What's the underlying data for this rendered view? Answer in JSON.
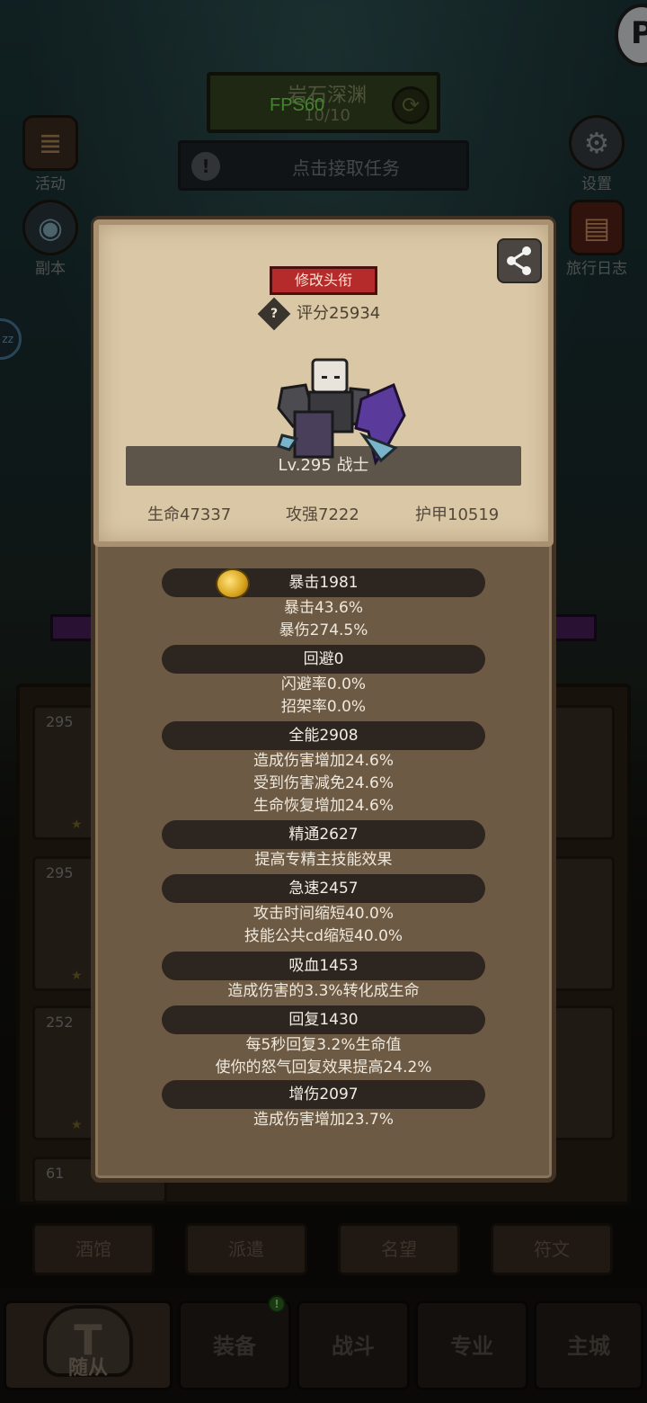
{
  "hud": {
    "zone_name": "岩石深渊",
    "zone_progress": "10/10",
    "fps": "FPS60",
    "quest_text": "点击接取任务",
    "left_buttons": [
      "活动",
      "副本"
    ],
    "right_buttons": [
      "设置",
      "旅行日志"
    ],
    "profile_badge": "P",
    "sleep_badge": "zz"
  },
  "background": {
    "card_levels": [
      "295",
      "295",
      "252",
      "61"
    ],
    "sub_buttons": [
      "酒馆",
      "派遣",
      "名望",
      "符文"
    ]
  },
  "nav": {
    "tabs": [
      "随从",
      "装备",
      "战斗",
      "专业",
      "主城"
    ],
    "badge": "!"
  },
  "panel": {
    "edit_title_label": "修改头衔",
    "score": "评分25934",
    "score_help": "?",
    "level_class": "Lv.295 战士",
    "base_stats": {
      "hp": "生命47337",
      "attack": "攻强7222",
      "armor": "护甲10519"
    },
    "attributes": [
      {
        "name": "暴击1981",
        "lines": [
          "暴击43.6%",
          "暴伤274.5%"
        ]
      },
      {
        "name": "回避0",
        "lines": [
          "闪避率0.0%",
          "招架率0.0%"
        ]
      },
      {
        "name": "全能2908",
        "lines": [
          "造成伤害增加24.6%",
          "受到伤害减免24.6%",
          "生命恢复增加24.6%"
        ]
      },
      {
        "name": "精通2627",
        "lines": [
          "提高专精主技能效果"
        ]
      },
      {
        "name": "急速2457",
        "lines": [
          "攻击时间缩短40.0%",
          "技能公共cd缩短40.0%"
        ]
      },
      {
        "name": "吸血1453",
        "lines": [
          "造成伤害的3.3%转化成生命"
        ]
      },
      {
        "name": "回复1430",
        "lines": [
          "每5秒回复3.2%生命值",
          "使你的怒气回复效果提高24.2%"
        ]
      },
      {
        "name": "增伤2097",
        "lines": [
          "造成伤害增加23.7%"
        ]
      }
    ]
  },
  "colors": {
    "panel_bg": "#6c5a44",
    "card_bg": "#d9c7a6",
    "title_button": "#b52a2a",
    "attr_header": "#2d2620",
    "fps_text": "#7cf05a"
  },
  "icons": [
    "share-icon",
    "help-icon",
    "coin-icon",
    "refresh-icon",
    "bell-icon",
    "gear-icon",
    "book-icon",
    "helmet-icon"
  ]
}
